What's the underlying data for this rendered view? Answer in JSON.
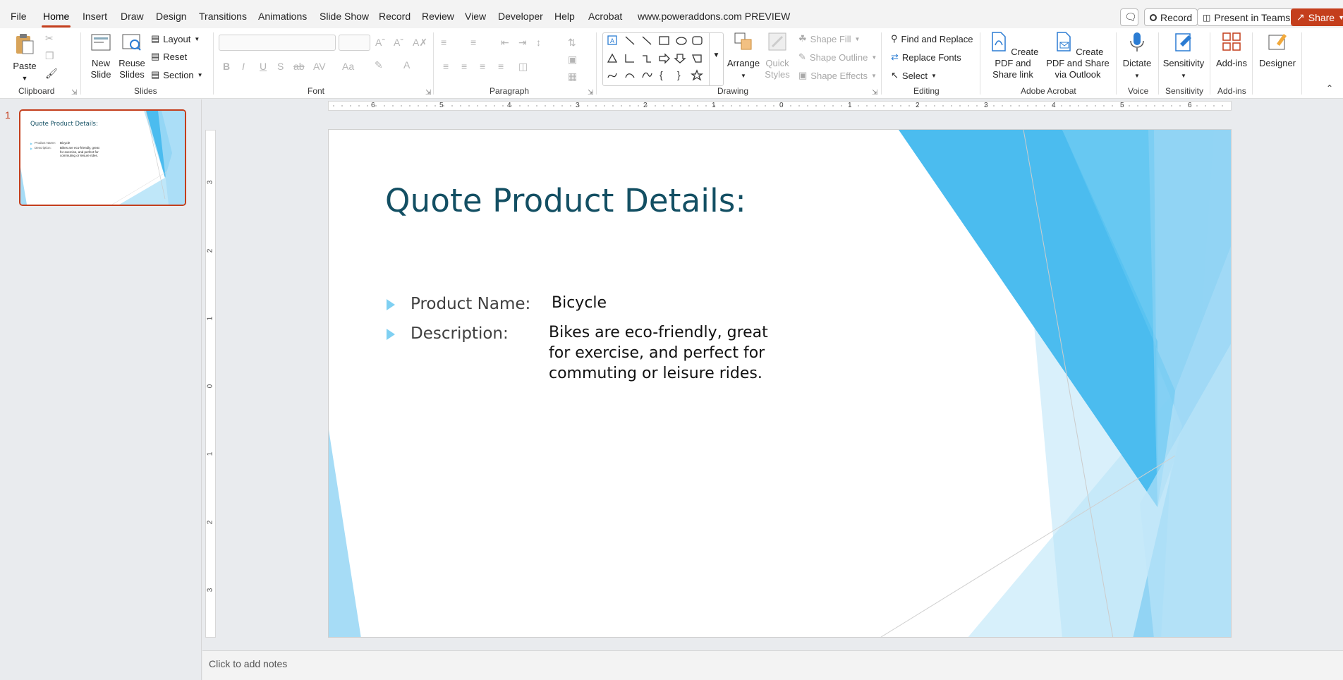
{
  "menu": {
    "tabs": [
      "File",
      "Home",
      "Insert",
      "Draw",
      "Design",
      "Transitions",
      "Animations",
      "Slide Show",
      "Record",
      "Review",
      "View",
      "Developer",
      "Help",
      "Acrobat",
      "www.poweraddons.com PREVIEW"
    ],
    "active_tab": "Home",
    "record_label": "Record",
    "present_label": "Present in Teams",
    "share_label": "Share"
  },
  "ribbon": {
    "clipboard": {
      "paste": "Paste",
      "group": "Clipboard"
    },
    "slides": {
      "new_slide": "New Slide",
      "reuse_slides": "Reuse Slides",
      "layout": "Layout",
      "reset": "Reset",
      "section": "Section",
      "group": "Slides"
    },
    "font": {
      "group": "Font",
      "bold": "B",
      "italic": "I",
      "underline": "U",
      "strike": "S",
      "shadow": "ab",
      "spacing": "AV",
      "case": "Aa"
    },
    "paragraph": {
      "group": "Paragraph"
    },
    "drawing": {
      "arrange": "Arrange",
      "quick_styles": "Quick Styles",
      "shape_fill": "Shape Fill",
      "shape_outline": "Shape Outline",
      "shape_effects": "Shape Effects",
      "group": "Drawing"
    },
    "editing": {
      "find_replace": "Find and Replace",
      "replace_fonts": "Replace Fonts",
      "select": "Select",
      "group": "Editing"
    },
    "acrobat": {
      "create_share": "Create PDF and Share link",
      "create_outlook": "Create PDF and Share via Outlook",
      "group": "Adobe Acrobat"
    },
    "voice": {
      "dictate": "Dictate",
      "group": "Voice"
    },
    "sensitivity": {
      "label": "Sensitivity",
      "group": "Sensitivity"
    },
    "addins": {
      "label": "Add-ins",
      "group": "Add-ins"
    },
    "designer": {
      "label": "Designer"
    }
  },
  "thumbnail": {
    "number": "1",
    "title": "Quote Product Details:",
    "rows": [
      {
        "label": "Product Name:",
        "value": "Bicycle"
      },
      {
        "label": "Description:",
        "value": "Bikes are eco-friendly, great for exercise, and perfect for commuting or leisure rides."
      }
    ]
  },
  "rulers": {
    "horizontal": [
      "6",
      "5",
      "4",
      "3",
      "2",
      "1",
      "0",
      "1",
      "2",
      "3",
      "4",
      "5",
      "6"
    ],
    "vertical": [
      "3",
      "2",
      "1",
      "0",
      "1",
      "2",
      "3"
    ]
  },
  "slide": {
    "title": "Quote Product Details:",
    "product_label": "Product Name:",
    "product_value": "Bicycle",
    "description_label": "Description:",
    "description_value": "Bikes are eco-friendly, great for exercise, and perfect for commuting or leisure rides.",
    "description_lines": [
      "Bikes are eco-friendly, great",
      "for exercise, and perfect for",
      "commuting or leisure rides."
    ]
  },
  "notes": {
    "placeholder": "Click to add notes"
  },
  "colors": {
    "accent": "#c43e1c",
    "title": "#134f63",
    "decoration": "#4bbcef"
  }
}
